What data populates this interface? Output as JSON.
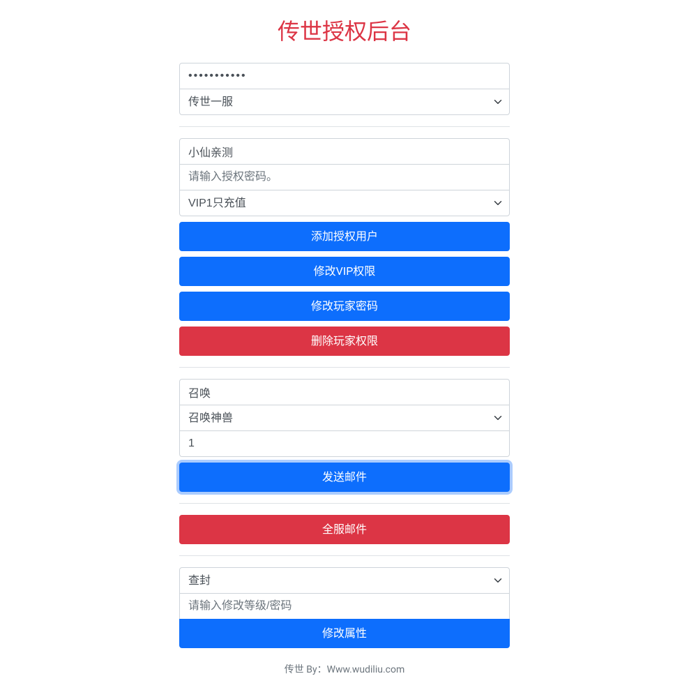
{
  "title": "传世授权后台",
  "section1": {
    "password_value": "•••••••••••",
    "server_select": "传世一服"
  },
  "section2": {
    "username_value": "小仙亲测",
    "auth_password_placeholder": "请输入授权密码。",
    "vip_select": "VIP1只充值",
    "btn_add_auth": "添加授权用户",
    "btn_modify_vip": "修改VIP权限",
    "btn_modify_password": "修改玩家密码",
    "btn_delete_player": "删除玩家权限"
  },
  "section3": {
    "summon_value": "召唤",
    "summon_select": "召唤神兽",
    "quantity_value": "1",
    "btn_send_mail": "发送邮件"
  },
  "section4": {
    "btn_global_mail": "全服邮件"
  },
  "section5": {
    "action_select": "查封",
    "level_password_placeholder": "请输入修改等级/密码",
    "btn_modify_attr": "修改属性"
  },
  "footer": "传世 By：Www.wudiliu.com"
}
